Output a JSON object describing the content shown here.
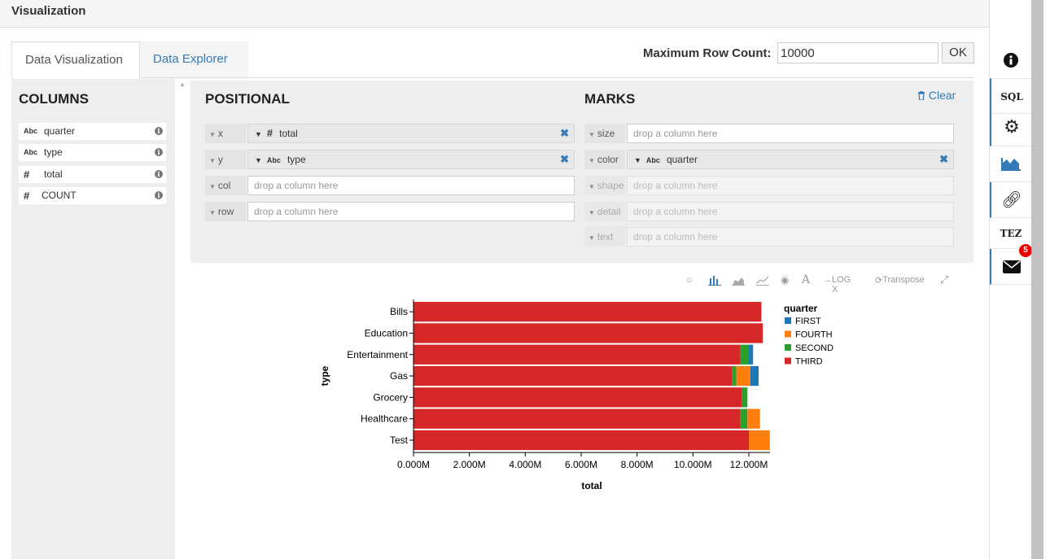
{
  "header": {
    "title": "Visualization"
  },
  "tabs": [
    {
      "label": "Data Visualization",
      "active": true
    },
    {
      "label": "Data Explorer",
      "active": false
    }
  ],
  "max_row": {
    "label": "Maximum Row Count:",
    "value": "10000",
    "ok_label": "OK"
  },
  "columns": {
    "title": "COLUMNS",
    "items": [
      {
        "type_icon": "Abc",
        "name": "quarter"
      },
      {
        "type_icon": "Abc",
        "name": "type"
      },
      {
        "type_icon": "#",
        "name": "total"
      },
      {
        "type_icon": "#",
        "name": "COUNT"
      }
    ]
  },
  "positional": {
    "title": "POSITIONAL",
    "shelves": [
      {
        "label": "x",
        "field": "total",
        "type_icon": "#"
      },
      {
        "label": "y",
        "field": "type",
        "type_icon": "Abc"
      },
      {
        "label": "col",
        "placeholder": "drop a column here"
      },
      {
        "label": "row",
        "placeholder": "drop a column here"
      }
    ]
  },
  "marks": {
    "title": "MARKS",
    "clear_label": "Clear",
    "shelves": [
      {
        "label": "size",
        "placeholder": "drop a column here"
      },
      {
        "label": "color",
        "field": "quarter",
        "type_icon": "Abc"
      },
      {
        "label": "shape",
        "placeholder": "drop a column here"
      },
      {
        "label": "detail",
        "placeholder": "drop a column here"
      },
      {
        "label": "text",
        "placeholder": "drop a column here"
      }
    ]
  },
  "toolbar": {
    "log_label": "LOG X",
    "transpose_label": "Transpose"
  },
  "sidebar": {
    "sql_label": "SQL",
    "tez_label": "TEZ",
    "mail_count": "5"
  },
  "chart_data": {
    "type": "bar",
    "orientation": "horizontal",
    "stacked": true,
    "categories": [
      "Bills",
      "Education",
      "Entertainment",
      "Gas",
      "Grocery",
      "Healthcare",
      "Test"
    ],
    "series": [
      {
        "name": "THIRD",
        "color": "#d62728",
        "values": [
          12.45,
          12.5,
          11.7,
          11.4,
          11.75,
          11.7,
          12.0
        ]
      },
      {
        "name": "SECOND",
        "color": "#2ca02c",
        "values": [
          0,
          0,
          0.3,
          0.15,
          0.2,
          0.25,
          0
        ]
      },
      {
        "name": "FOURTH",
        "color": "#ff7f0e",
        "values": [
          0,
          0,
          0,
          0.5,
          0,
          0.45,
          0.75
        ]
      },
      {
        "name": "FIRST",
        "color": "#1f77b4",
        "values": [
          0,
          0,
          0.15,
          0.3,
          0,
          0,
          0
        ]
      }
    ],
    "legend": {
      "title": "quarter",
      "items": [
        "FIRST",
        "FOURTH",
        "SECOND",
        "THIRD"
      ],
      "colors": [
        "#1f77b4",
        "#ff7f0e",
        "#2ca02c",
        "#d62728"
      ],
      "position": "right"
    },
    "xlabel": "total",
    "ylabel": "type",
    "xticks": [
      "0.000M",
      "2.000M",
      "4.000M",
      "6.000M",
      "8.000M",
      "10.000M",
      "12.000M"
    ],
    "xlim": [
      0,
      12.5
    ]
  }
}
